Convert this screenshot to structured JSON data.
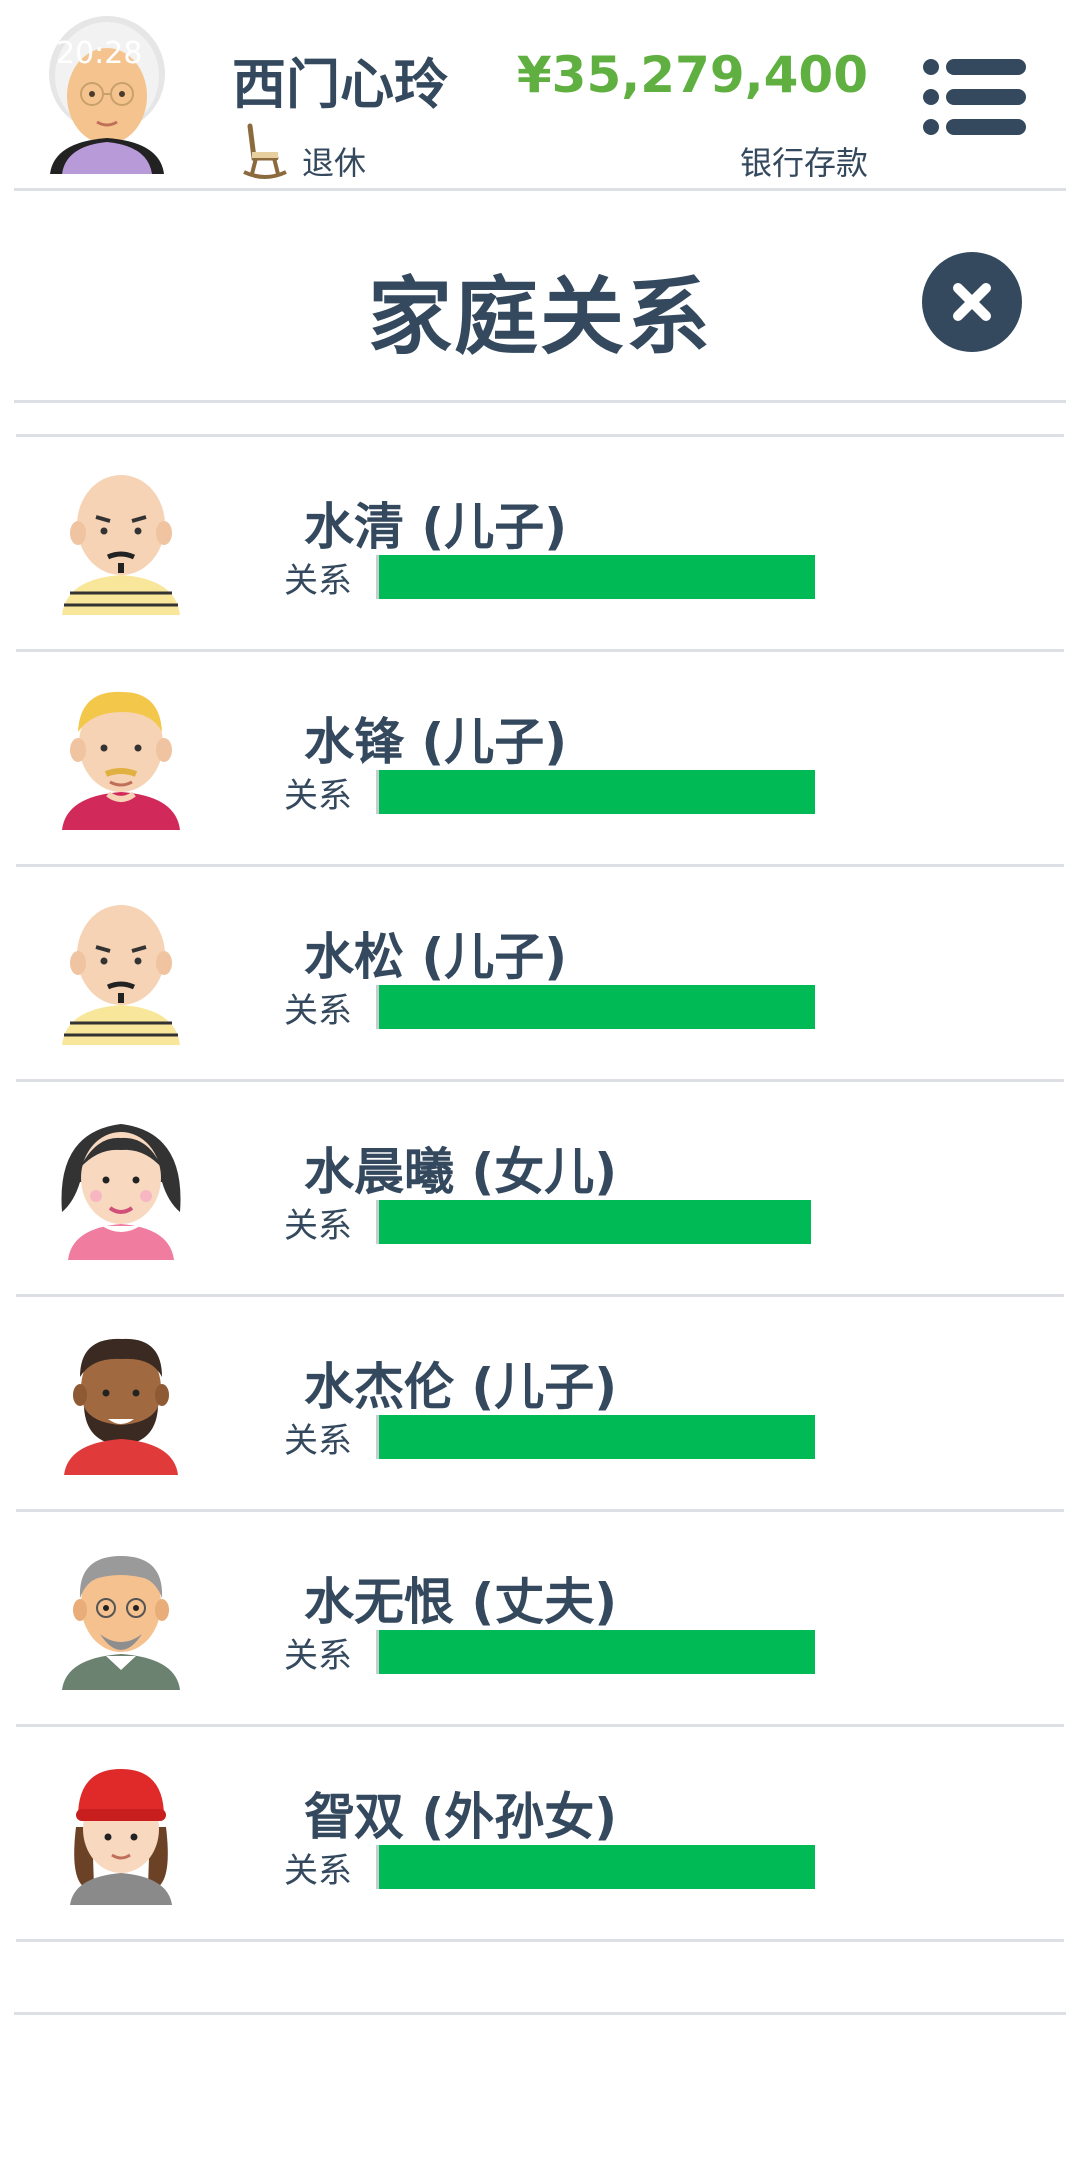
{
  "status_bar": {
    "time": "20:28"
  },
  "header": {
    "player_name": "西门心玲",
    "job_status": "退休",
    "money": "¥35,279,400",
    "money_label": "银行存款",
    "job_icon": "rocking-chair-icon",
    "menu_icon": "menu-list-icon"
  },
  "modal": {
    "title": "家庭关系",
    "close_icon": "close-icon"
  },
  "relation_label": "关系",
  "relations": [
    {
      "name": "水清 (儿子)",
      "level": 1.0,
      "avatar": "bald-mustache-man"
    },
    {
      "name": "水锋 (儿子)",
      "level": 1.0,
      "avatar": "blond-man"
    },
    {
      "name": "水松 (儿子)",
      "level": 1.0,
      "avatar": "bald-mustache-man"
    },
    {
      "name": "水晨曦 (女儿)",
      "level": 0.99,
      "avatar": "dark-hair-woman"
    },
    {
      "name": "水杰伦 (儿子)",
      "level": 1.0,
      "avatar": "bearded-man"
    },
    {
      "name": "水无恨 (丈夫)",
      "level": 1.0,
      "avatar": "older-bearded-man"
    },
    {
      "name": "眢双 (外孙女)",
      "level": 1.0,
      "avatar": "girl-red-hat"
    }
  ],
  "colors": {
    "text": "#34495e",
    "money": "#5fb041",
    "bar": "#00bb55",
    "divider": "#dcdfe3"
  }
}
